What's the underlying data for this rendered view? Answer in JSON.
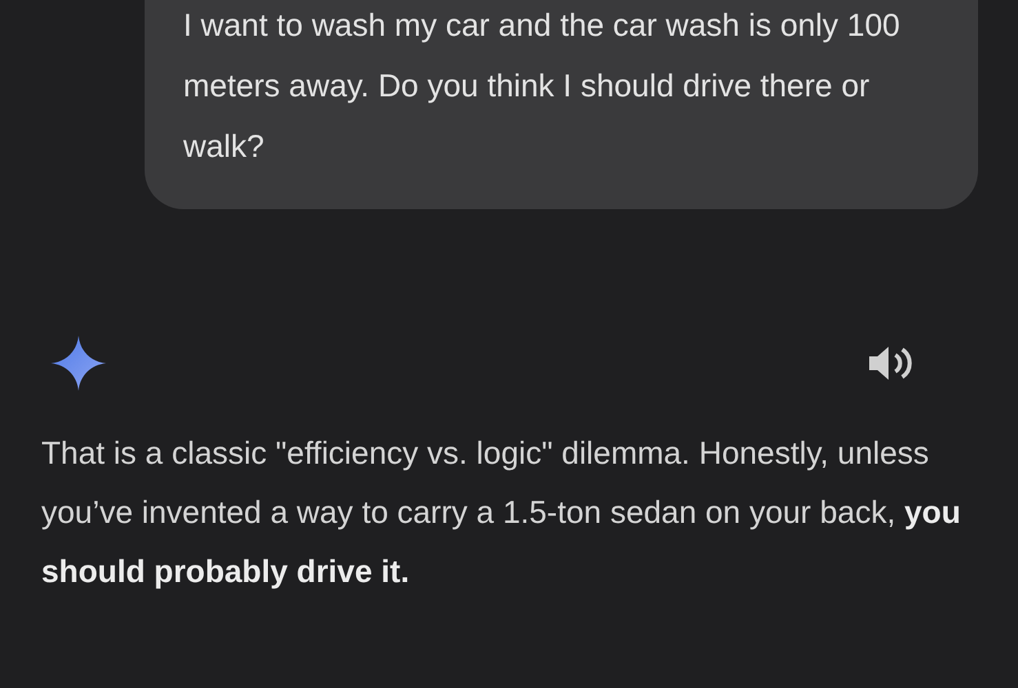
{
  "user_message": {
    "text": "I want to wash my car and the car wash is only 100 meters away. Do you think I should drive there or walk?"
  },
  "response": {
    "text": "That is a classic \"efficiency vs. logic\" dilemma. Honestly, unless you’ve invented a way to carry a 1.5-ton sedan on your back, **you should probably drive it.**"
  }
}
